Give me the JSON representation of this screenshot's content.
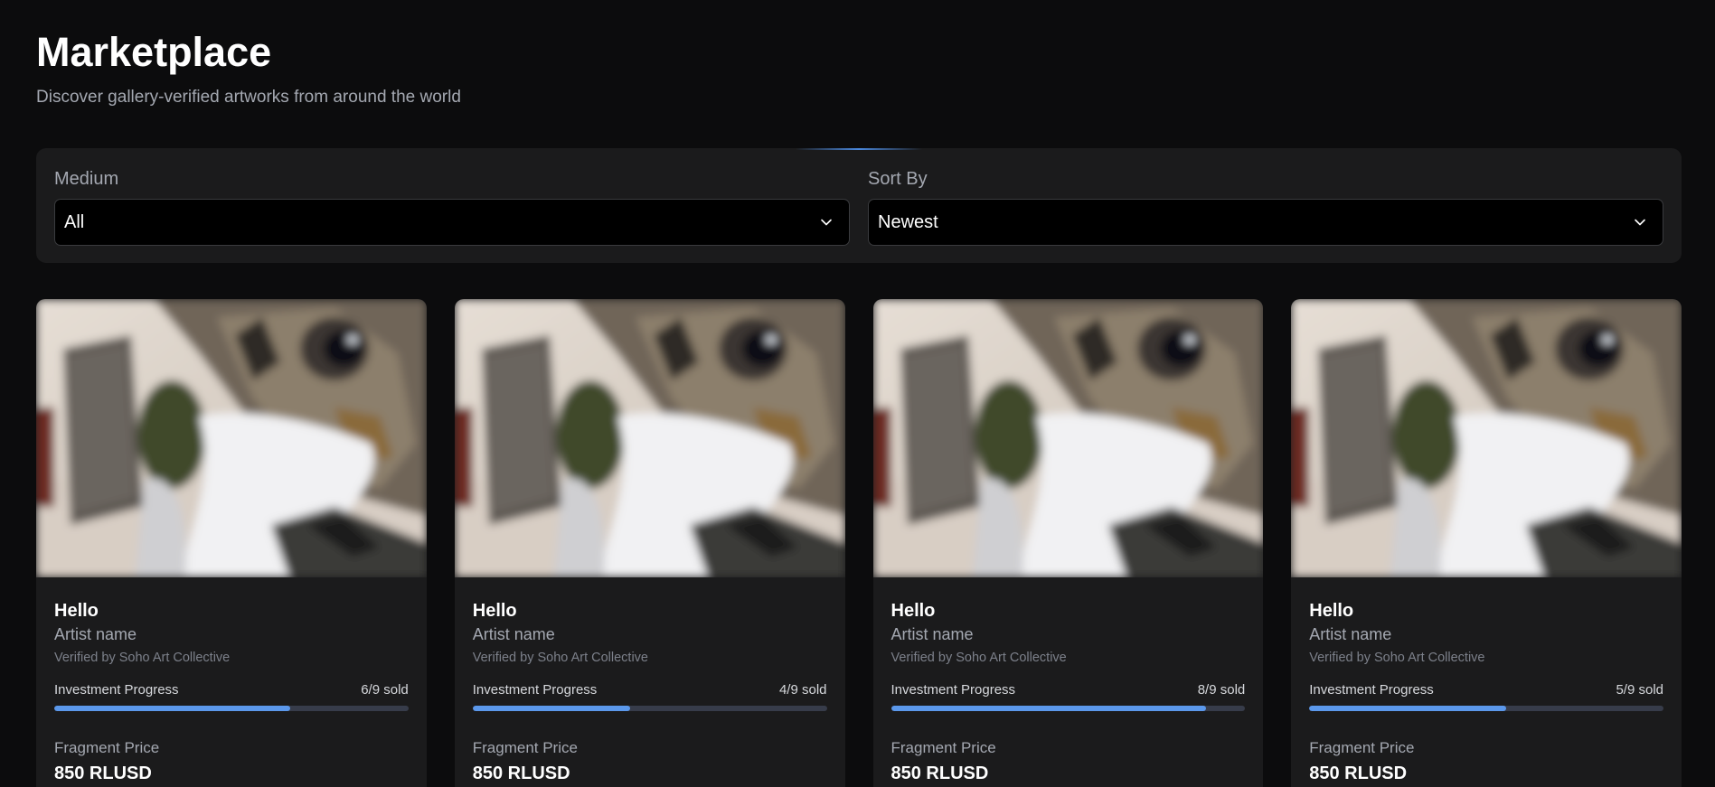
{
  "header": {
    "title": "Marketplace",
    "subtitle": "Discover gallery-verified artworks from around the world"
  },
  "filters": {
    "medium": {
      "label": "Medium",
      "value": "All"
    },
    "sort": {
      "label": "Sort By",
      "value": "Newest"
    }
  },
  "colors": {
    "background": "#0c0c0d",
    "panel": "#1b1b1c",
    "accent": "#5b98eb",
    "progress_track": "#373c4a",
    "muted_text": "#a4a8b1"
  },
  "cards": [
    {
      "title": "Hello",
      "artist": "Artist name",
      "verified": "Verified by Soho Art Collective",
      "progress_label": "Investment Progress",
      "sold_text": "6/9 sold",
      "sold": 6,
      "total": 9,
      "price_label": "Fragment Price",
      "price": "850 RLUSD",
      "image": "cat-photo"
    },
    {
      "title": "Hello",
      "artist": "Artist name",
      "verified": "Verified by Soho Art Collective",
      "progress_label": "Investment Progress",
      "sold_text": "4/9 sold",
      "sold": 4,
      "total": 9,
      "price_label": "Fragment Price",
      "price": "850 RLUSD",
      "image": "cat-photo"
    },
    {
      "title": "Hello",
      "artist": "Artist name",
      "verified": "Verified by Soho Art Collective",
      "progress_label": "Investment Progress",
      "sold_text": "8/9 sold",
      "sold": 8,
      "total": 9,
      "price_label": "Fragment Price",
      "price": "850 RLUSD",
      "image": "cat-photo"
    },
    {
      "title": "Hello",
      "artist": "Artist name",
      "verified": "Verified by Soho Art Collective",
      "progress_label": "Investment Progress",
      "sold_text": "5/9 sold",
      "sold": 5,
      "total": 9,
      "price_label": "Fragment Price",
      "price": "850 RLUSD",
      "image": "cat-photo"
    }
  ]
}
